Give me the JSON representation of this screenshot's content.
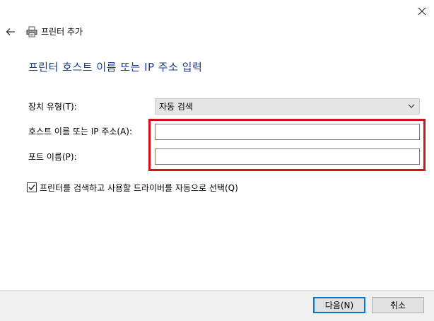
{
  "window": {
    "title": "프린터 추가",
    "icons": {
      "close": "close-icon",
      "back": "back-arrow-icon",
      "printer": "printer-icon"
    }
  },
  "heading": "프린터 호스트 이름 또는 IP 주소 입력",
  "form": {
    "device_type_label": "장치 유형(T):",
    "device_type_value": "자동 검색",
    "host_label": "호스트 이름 또는 IP 주소(A):",
    "host_value": "",
    "port_label": "포트 이름(P):",
    "port_value": "",
    "auto_select_label": "프린터를 검색하고 사용할 드라이버를 자동으로 선택(Q)",
    "auto_select_checked": true
  },
  "buttons": {
    "next": "다음(N)",
    "cancel": "취소"
  },
  "colors": {
    "heading": "#1a3a8a",
    "highlight_box": "#d0121b",
    "primary_border": "#0078d7"
  }
}
